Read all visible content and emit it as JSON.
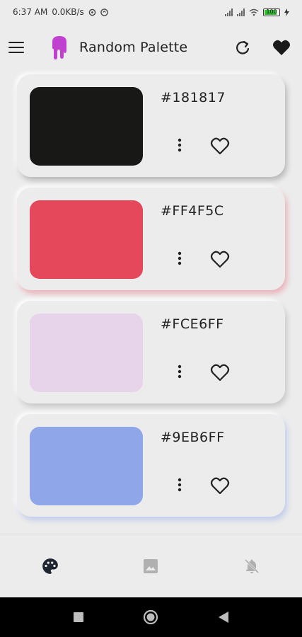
{
  "status": {
    "time": "6:37 AM",
    "speed": "0.0KB/s",
    "battery": "100"
  },
  "header": {
    "title": "Random Palette",
    "logo_color": "#c040d0"
  },
  "palette": [
    {
      "hex": "#181817",
      "color": "#181817"
    },
    {
      "hex": "#FF4F5C",
      "color": "#e5485a"
    },
    {
      "hex": "#FCE6FF",
      "color": "#e8d4ea"
    },
    {
      "hex": "#9EB6FF",
      "color": "#8fa6e8"
    }
  ],
  "bottom_nav": {
    "items": [
      {
        "name": "palette-icon",
        "active": true
      },
      {
        "name": "image-icon",
        "active": false
      },
      {
        "name": "notifications-off-icon",
        "active": false
      }
    ]
  },
  "colors": {
    "background": "#ececec",
    "text": "#222222",
    "inactive_icon": "#b0b0b0"
  }
}
